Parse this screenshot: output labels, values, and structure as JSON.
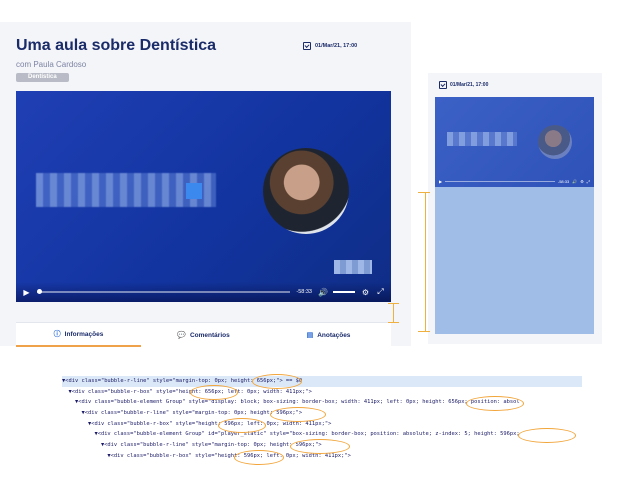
{
  "left_page": {
    "title": "Uma aula sobre Dentística",
    "author": "com Paula Cardoso",
    "tag": "Dentística",
    "date": "01/Mar/21, 17:00",
    "video": {
      "time": "-58:33",
      "play_icon": "play-icon",
      "volume_icon": "volume-icon",
      "settings_icon": "gear-icon",
      "fullscreen_icon": "fullscreen-icon"
    },
    "tabs": [
      {
        "label": "Informações",
        "icon": "info-icon",
        "active": true
      },
      {
        "label": "Comentários",
        "icon": "comments-icon",
        "active": false
      },
      {
        "label": "Anotações",
        "icon": "notes-icon",
        "active": false
      }
    ]
  },
  "right_page": {
    "date": "01/Mar/21, 17:00",
    "video_time": "-58:33"
  },
  "inspector": {
    "lines": [
      "▼<div class=\"bubble-r-line\" style=\"margin-top: 0px; height: 656px;\"> == $0",
      "  ▼<div class=\"bubble-r-box\" style=\"height: 656px; left: 0px; width: 411px;\">",
      "    ▼<div class=\"bubble-element Group\" style=\"display: block; box-sizing: border-box; width: 411px; left: 0px; height: 656px; position: absol",
      "      ▼<div class=\"bubble-r-line\" style=\"margin-top: 0px; height: 596px;\">",
      "        ▼<div class=\"bubble-r-box\" style=\"height: 596px; left: 0px; width: 411px;\">",
      "          ▼<div class=\"bubble-element Group\" id=\"player_static\" style=\"box-sizing: border-box; position: absolute; z-index: 5; height: 596px;",
      "            ▼<div class=\"bubble-r-line\" style=\"margin-top: 0px; height: 596px;\">",
      "              ▼<div class=\"bubble-r-box\" style=\"height: 596px; left: 0px; width: 411px;\">"
    ]
  },
  "colors": {
    "brand_navy": "#1a2b6a",
    "video_blue": "#1f3fb4",
    "highlight_orange": "#f0a24a",
    "placeholder_blue": "#9fbde6"
  }
}
